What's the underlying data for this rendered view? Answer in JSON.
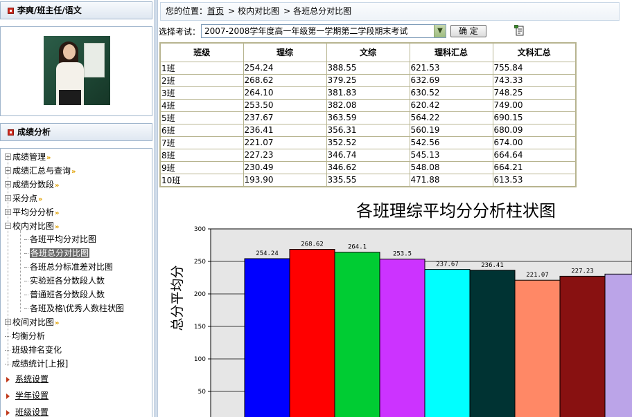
{
  "user": {
    "header": "李爽/班主任/语文"
  },
  "section": {
    "header": "成绩分析"
  },
  "menu": {
    "groups": [
      {
        "label": "成绩管理",
        "expanded": false
      },
      {
        "label": "成绩汇总与查询",
        "expanded": false
      },
      {
        "label": "成绩分数段",
        "expanded": false
      },
      {
        "label": "采分点",
        "expanded": false
      },
      {
        "label": "平均分分析",
        "expanded": false
      },
      {
        "label": "校内对比图",
        "expanded": true
      },
      {
        "label": "校间对比图",
        "expanded": false
      }
    ],
    "children": [
      {
        "label": "各班平均分对比图"
      },
      {
        "label": "各班总分对比图",
        "selected": true
      },
      {
        "label": "各班总分标准差对比图"
      },
      {
        "label": "实验班各分数段人数"
      },
      {
        "label": "普通班各分数段人数"
      },
      {
        "label": "各班及格\\优秀人数柱状图"
      }
    ],
    "plain": [
      {
        "label": "均衡分析"
      },
      {
        "label": "班级排名变化"
      },
      {
        "label": "成绩统计[上报]"
      }
    ],
    "links": [
      {
        "label": "系统设置"
      },
      {
        "label": "学年设置"
      },
      {
        "label": "班级设置"
      }
    ]
  },
  "breadcrumb": {
    "prefix": "您的位置：",
    "home": "首页",
    "sep": ">",
    "level1": "校内对比图",
    "level2": "各班总分对比图"
  },
  "exam": {
    "label": "选择考试：",
    "selected": "2007-2008学年度高一年级第一学期第二学段期末考试",
    "confirm": "确  定"
  },
  "table": {
    "headers": [
      "班级",
      "理综",
      "文综",
      "理科汇总",
      "文科汇总"
    ],
    "rows": [
      [
        "1班",
        "254.24",
        "388.55",
        "621.53",
        "755.84"
      ],
      [
        "2班",
        "268.62",
        "379.25",
        "632.69",
        "743.33"
      ],
      [
        "3班",
        "264.10",
        "381.83",
        "630.52",
        "748.25"
      ],
      [
        "4班",
        "253.50",
        "382.08",
        "620.42",
        "749.00"
      ],
      [
        "5班",
        "237.67",
        "363.59",
        "564.22",
        "690.15"
      ],
      [
        "6班",
        "236.41",
        "356.31",
        "560.19",
        "680.09"
      ],
      [
        "7班",
        "221.07",
        "352.52",
        "542.56",
        "674.00"
      ],
      [
        "8班",
        "227.23",
        "346.74",
        "545.13",
        "664.64"
      ],
      [
        "9班",
        "230.49",
        "346.62",
        "548.08",
        "664.21"
      ],
      [
        "10班",
        "193.90",
        "335.55",
        "471.88",
        "613.53"
      ]
    ]
  },
  "chart_data": {
    "type": "bar",
    "title": "各班理综平均分分析柱状图",
    "ylabel": "总分平均分",
    "xlabel": "",
    "ylim": [
      0,
      300
    ],
    "yticks": [
      50,
      100,
      150,
      200,
      250,
      300
    ],
    "grid": true,
    "values": [
      254.24,
      268.62,
      264.1,
      253.5,
      237.67,
      236.41,
      221.07,
      227.23,
      230.49
    ],
    "labels": [
      "254.24",
      "268.62",
      "264.1",
      "253.5",
      "237.67",
      "236.41",
      "221.07",
      "227.23",
      ""
    ],
    "colors": [
      "#0000ff",
      "#ff0000",
      "#00cc33",
      "#cc33ff",
      "#00ffff",
      "#003333",
      "#ff8866",
      "#881111",
      "#bba4e8"
    ]
  },
  "colors": {
    "accent_red": "#cc2b1f",
    "border_blue": "#9fb5cc",
    "table_border": "#b7b48f"
  }
}
